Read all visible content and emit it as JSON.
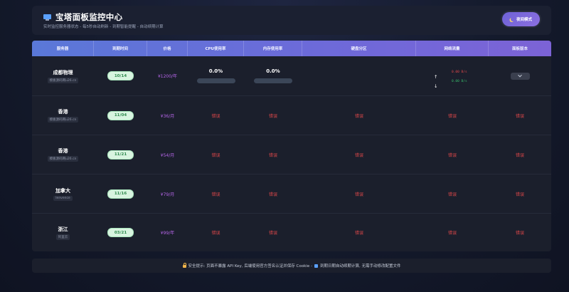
{
  "header": {
    "title": "宝塔面板监控中心",
    "subtitle": "实时监控服务器状态 - 每5秒自动刷新 - 到期智能提醒 - 自动续期计算",
    "night_mode_label": "夜间模式"
  },
  "columns": [
    "服务器",
    "到期时间",
    "价格",
    "CPU使用率",
    "内存使用率",
    "硬盘分区",
    "网络流量",
    "面板版本"
  ],
  "rows": [
    {
      "name": "成都物理",
      "tag": "模板源码网u26.cn",
      "expiry": "10/14",
      "price": "¥1200/年",
      "cpu": "0.0%",
      "cpu_level": 0,
      "mem": "0.0%",
      "mem_level": 0,
      "disk": "",
      "net_up": "0.00 B/s",
      "net_down": "0.00 B/s",
      "version": ""
    },
    {
      "name": "香港",
      "tag": "模板源码网u26.cn",
      "expiry": "11/04",
      "price": "¥36/月",
      "cpu": "错误",
      "mem": "错误",
      "disk": "错误",
      "net": "错误",
      "version": "错误"
    },
    {
      "name": "香港",
      "tag": "模板源码网u26.cn",
      "expiry": "11/21",
      "price": "¥54/月",
      "cpu": "错误",
      "mem": "错误",
      "disk": "错误",
      "net": "错误",
      "version": "错误"
    },
    {
      "name": "加拿大",
      "tag": "lenvence",
      "expiry": "11/16",
      "price": "¥79/月",
      "cpu": "错误",
      "mem": "错误",
      "disk": "错误",
      "net": "错误",
      "version": "错误"
    },
    {
      "name": "浙江",
      "tag": "阿里云",
      "expiry": "03/21",
      "price": "¥99/年",
      "cpu": "错误",
      "mem": "错误",
      "disk": "错误",
      "net": "错误",
      "version": "错误"
    }
  ],
  "footer": {
    "security_text": "安全提示: 页面不暴露 API Key, 后端使用官方签名认证并保存 Cookie -",
    "expiry_text": "到期日期自动续期计算, 无需手动修改配置文件"
  },
  "icons": {
    "title": "monitor-icon",
    "night": "moon-icon",
    "footer_security": "lock-icon",
    "footer_calendar": "calendar-icon",
    "net_up": "arrow-up-icon",
    "net_down": "arrow-down-icon",
    "version": "chevron-down-icon"
  },
  "colors": {
    "accent": "#6e62d6",
    "price": "#b565e8",
    "error": "#e0484a",
    "pill_bg": "#d8f4e0",
    "pill_text": "#2f8a4e"
  }
}
